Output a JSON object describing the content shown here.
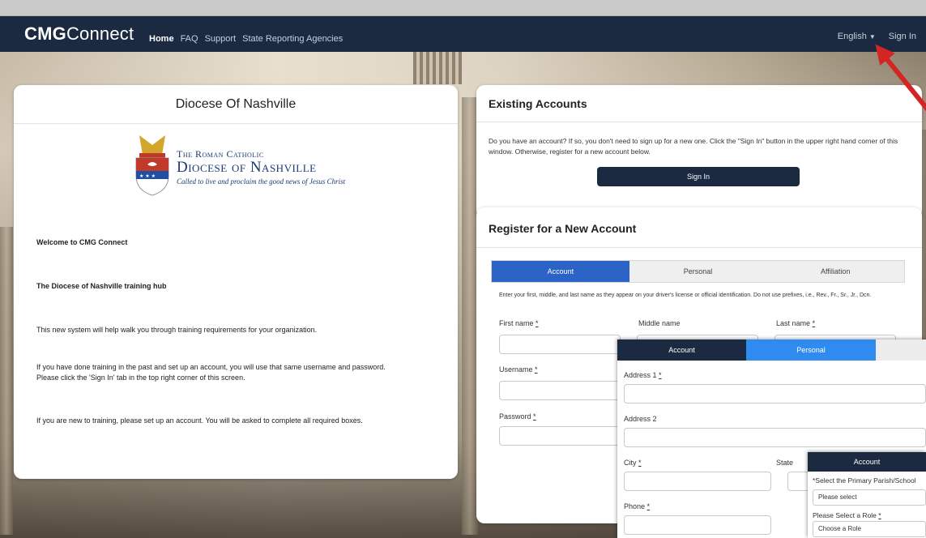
{
  "nav": {
    "brand_bold": "CMG",
    "brand_rest": "Connect",
    "links": [
      "Home",
      "FAQ",
      "Support",
      "State Reporting Agencies"
    ],
    "language": "English",
    "sign_in": "Sign In"
  },
  "left_card": {
    "title": "Diocese Of Nashville",
    "logo_line1": "The Roman Catholic",
    "logo_line2": "Diocese of Nashville",
    "logo_tagline": "Called to live and proclaim the good news of Jesus Christ",
    "welcome": "Welcome to CMG Connect",
    "hub": "The Diocese of Nashville training hub",
    "p1": "This new system will help walk you through training requirements for your organization.",
    "p2a": "If you have done training in the past and set up an account, you will use that same username and password.",
    "p2b": "Please click the 'Sign In' tab in the top right corner of this screen.",
    "p3": "If you are new to training, please set up an account.  You will be asked to complete all required boxes."
  },
  "existing": {
    "title": "Existing Accounts",
    "text": "Do you have an account? If so, you don't need to sign up for a new one. Click the \"Sign In\" button in the upper right hand corner of this window. Otherwise, register for a new account below.",
    "button": "Sign In"
  },
  "register": {
    "title": "Register for a New Account",
    "tabs": [
      "Account",
      "Personal",
      "Affiliation"
    ],
    "note": "Enter your first, middle, and last name as they appear on your driver's license or official identification. Do not use prefixes, i.e., Rev., Fr., Sr., Jr., Dcn.",
    "first_name": "First name",
    "middle_name": "Middle name",
    "last_name": "Last name",
    "username": "Username",
    "password": "Password",
    "required": "*"
  },
  "overlay1": {
    "tabs": [
      "Account",
      "Personal"
    ],
    "address1": "Address 1",
    "address2": "Address 2",
    "city": "City",
    "state": "State",
    "phone": "Phone",
    "required": "*"
  },
  "overlay2": {
    "tab": "Account",
    "parish_label": "*Select the Primary Parish/School",
    "parish_value": "Please select",
    "role_label": "Please Select a Role",
    "role_value": "Choose a Role",
    "required": "*"
  },
  "colors": {
    "navbar": "#1b2a41",
    "active_tab": "#2b63c6",
    "arrow": "#d42525"
  }
}
